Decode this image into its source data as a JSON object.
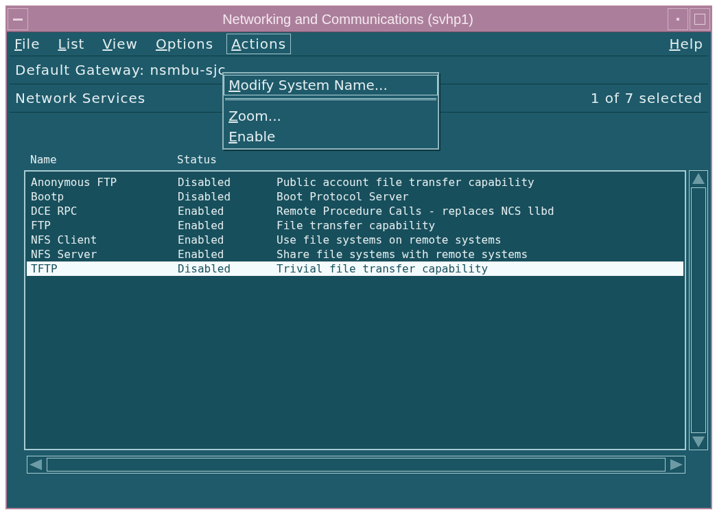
{
  "window": {
    "title": "Networking and Communications (svhp1)"
  },
  "menubar": [
    {
      "label": "File",
      "selected": false
    },
    {
      "label": "List",
      "selected": false
    },
    {
      "label": "View",
      "selected": false
    },
    {
      "label": "Options",
      "selected": false
    },
    {
      "label": "Actions",
      "selected": true
    }
  ],
  "help_menu": "Help",
  "dropdown": [
    {
      "kind": "item",
      "label": "Modify System Name...",
      "selected": true
    },
    {
      "kind": "separator"
    },
    {
      "kind": "item",
      "label": "Zoom...",
      "selected": false
    },
    {
      "kind": "item",
      "label": "Enable",
      "selected": false
    }
  ],
  "gateway": "Default Gateway: nsmbu-sjc",
  "section": {
    "title": "Network Services",
    "count": "1 of 7 selected"
  },
  "table": {
    "columns": [
      "Name",
      "Status"
    ],
    "rows": [
      {
        "name": "Anonymous FTP",
        "status": "Disabled",
        "description": "Public account file transfer capability",
        "selected": false
      },
      {
        "name": "Bootp",
        "status": "Disabled",
        "description": "Boot Protocol Server",
        "selected": false
      },
      {
        "name": "DCE RPC",
        "status": "Enabled",
        "description": "Remote Procedure Calls - replaces NCS llbd",
        "selected": false
      },
      {
        "name": "FTP",
        "status": "Enabled",
        "description": "File transfer capability",
        "selected": false
      },
      {
        "name": "NFS Client",
        "status": "Enabled",
        "description": "Use file systems on remote systems",
        "selected": false
      },
      {
        "name": "NFS Server",
        "status": "Enabled",
        "description": "Share file systems with remote systems",
        "selected": false
      },
      {
        "name": "TFTP",
        "status": "Disabled",
        "description": "Trivial file transfer capability",
        "selected": true
      }
    ]
  }
}
